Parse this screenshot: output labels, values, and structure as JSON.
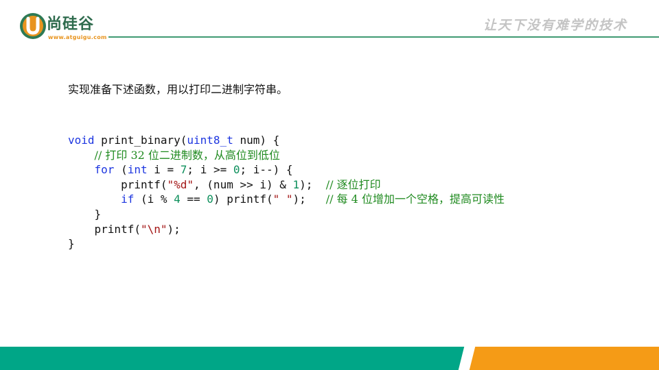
{
  "brand": {
    "name": "尚硅谷",
    "url": "www.atguigu.com",
    "slogan": "让天下没有难学的技术",
    "colors": {
      "green": "#00a687",
      "orange": "#f59b16",
      "dark_green": "#2e6b4d"
    }
  },
  "slide": {
    "intro": "实现准备下述函数，用以打印二进制字符串。"
  },
  "code": {
    "line1": {
      "kw": "void",
      "fn": " print_binary(",
      "ty": "uint8_t",
      "rest": " num) {"
    },
    "line2": {
      "indent": "    ",
      "comment": "// 打印 32 位二进制数，从高位到低位"
    },
    "line3": {
      "indent": "    ",
      "kw_for": "for",
      "p1": " (",
      "kw_int": "int",
      "p2": " i = ",
      "n7": "7",
      "p3": "; i >= ",
      "n0": "0",
      "p4": "; i--) {"
    },
    "line4": {
      "indent": "        ",
      "p1": "printf(",
      "str": "\"%d\"",
      "p2": ", (num >> i) & ",
      "n1": "1",
      "p3": ");  ",
      "comment": "// 逐位打印"
    },
    "line5": {
      "indent": "        ",
      "kw_if": "if",
      "p1": " (i % ",
      "n4": "4",
      "p2": " == ",
      "n0": "0",
      "p3": ") printf(",
      "str": "\" \"",
      "p4": ");   ",
      "comment": "// 每 4 位增加一个空格，提高可读性"
    },
    "line6": {
      "indent": "    ",
      "brace": "}"
    },
    "line7": {
      "indent": "    ",
      "p1": "printf(",
      "str": "\"\\n\"",
      "p2": ");"
    },
    "line8": {
      "brace": "}"
    }
  }
}
